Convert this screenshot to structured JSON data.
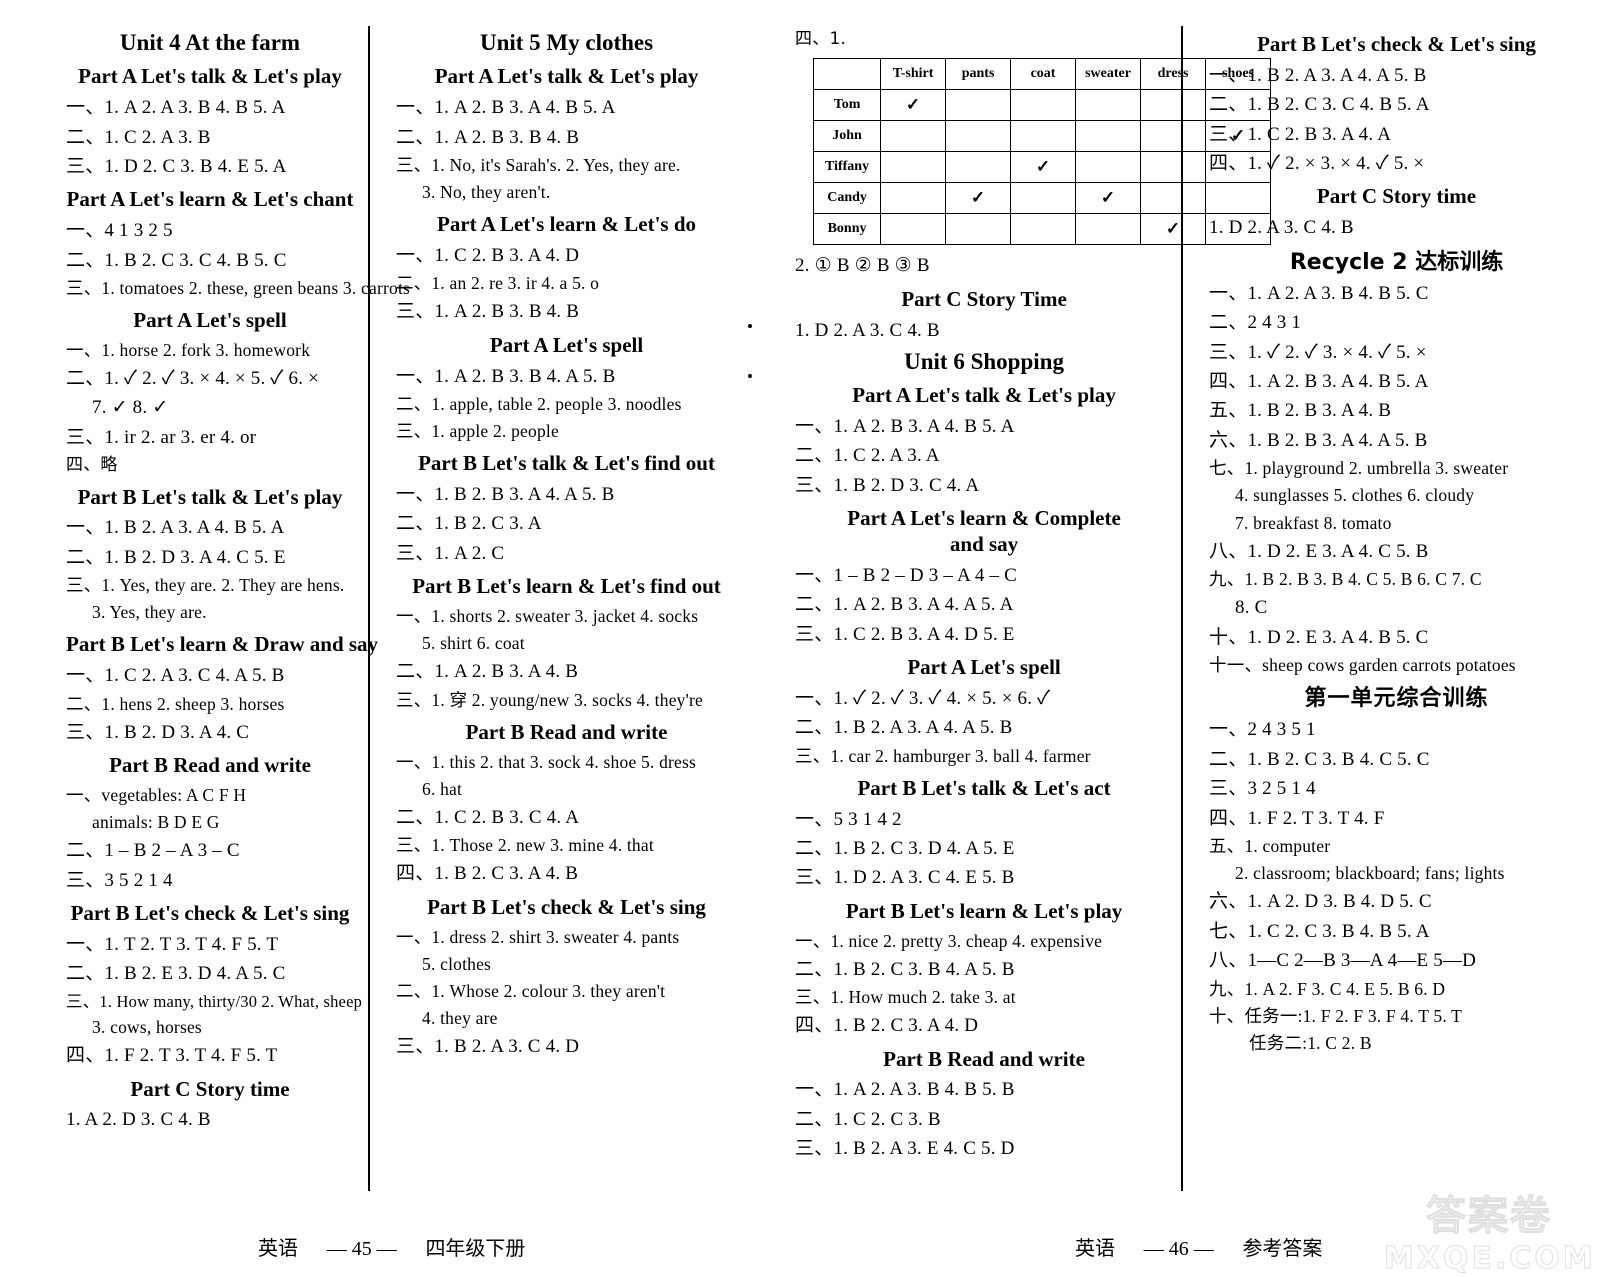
{
  "footer": {
    "left_subject": "英语",
    "left_page": "— 45 —",
    "left_book": "四年级下册",
    "right_subject": "英语",
    "right_page": "— 46 —",
    "right_book": "参考答案"
  },
  "watermark": {
    "line1": "答案卷",
    "line2": "MXQE.COM"
  },
  "col1": {
    "unit_title": "Unit 4    At the farm",
    "s1_header": "Part A    Let's talk & Let's play",
    "s1_l1": "一、1. A   2. A   3. B   4. B   5. A",
    "s1_l2": "二、1. C   2. A   3. B",
    "s1_l3": "三、1. D   2. C   3. B   4. E   5. A",
    "s2_header": "Part A    Let's learn & Let's chant",
    "s2_l1": "一、4   1   3   2   5",
    "s2_l2": "二、1. B   2. C   3. C   4. B   5. C",
    "s2_l3": "三、1. tomatoes   2. these, green beans   3. carrots",
    "s3_header": "Part A    Let's spell",
    "s3_l1": "一、1. horse   2. fork   3. homework",
    "s3_l2": "二、1. ✓   2. ✓   3. ×   4. ×   5. ✓   6. ×",
    "s3_l2b": "7. ✓   8. ✓",
    "s3_l3": "三、1. ir   2. ar   3. er   4. or",
    "s3_l4": "四、略",
    "s4_header": "Part B    Let's talk & Let's play",
    "s4_l1": "一、1. B   2. A   3. A   4. B   5. A",
    "s4_l2": "二、1. B   2. D   3. A   4. C   5. E",
    "s4_l3": "三、1. Yes, they are.    2. They are hens.",
    "s4_l3b": "3. Yes, they are.",
    "s5_header": "Part B    Let's learn & Draw and say",
    "s5_l1": "一、1. C   2. A   3. C   4. A   5. B",
    "s5_l2": "二、1. hens   2. sheep   3. horses",
    "s5_l3": "三、1. B   2. D   3. A   4. C",
    "s6_header": "Part B    Read and write",
    "s6_l1": "一、vegetables: A   C   F   H",
    "s6_l1b": "animals: B   D   E   G",
    "s6_l2": "二、1 – B   2 – A   3 – C",
    "s6_l3": "三、3   5   2   1   4",
    "s7_header": "Part B    Let's check & Let's sing",
    "s7_l1": "一、1. T   2. T   3. T   4. F   5. T",
    "s7_l2": "二、1. B   2. E   3. D   4. A   5. C",
    "s7_l3": "三、1. How many, thirty/30   2. What, sheep",
    "s7_l3b": "3. cows, horses",
    "s7_l4": "四、1. F   2. T   3. T   4. F   5. T",
    "s8_header": "Part C    Story time",
    "s8_l1": "1. A   2. D   3. C   4. B"
  },
  "col2": {
    "unit_title": "Unit 5    My clothes",
    "s1_header": "Part A    Let's talk & Let's play",
    "s1_l1": "一、1. A   2. B   3. A   4. B   5. A",
    "s1_l2": "二、1. A   2. B   3. B   4. B",
    "s1_l3": "三、1. No, it's Sarah's.    2. Yes, they are.",
    "s1_l3b": "3. No, they aren't.",
    "s2_header": "Part A    Let's learn & Let's do",
    "s2_l1": "一、1. C   2. B   3. A   4. D",
    "s2_l2": "二、1. an   2. re   3. ir   4. a   5. o",
    "s2_l3": "三、1. A   2. B   3. B   4. B",
    "s3_header": "Part A    Let's spell",
    "s3_l1": "一、1. A   2. B   3. B   4. A   5. B",
    "s3_l2": "二、1. apple, table   2. people   3. noodles",
    "s3_l3": "三、1. apple   2. people",
    "s4_header": "Part B    Let's talk & Let's find out",
    "s4_l1": "一、1. B   2. B   3. A   4. A   5. B",
    "s4_l2": "二、1. B   2. C   3. A",
    "s4_l3": "三、1. A   2. C",
    "s5_header": "Part B    Let's learn & Let's find out",
    "s5_l1": "一、1. shorts   2. sweater   3. jacket   4. socks",
    "s5_l1b": "5. shirt   6. coat",
    "s5_l2": "二、1. A   2. B   3. A   4. B",
    "s5_l3": "三、1. 穿   2. young/new   3. socks   4. they're",
    "s6_header": "Part B    Read and write",
    "s6_l1": "一、1. this   2. that   3. sock   4. shoe   5. dress",
    "s6_l1b": "6. hat",
    "s6_l2": "二、1. C   2. B   3. C   4. A",
    "s6_l3": "三、1. Those   2. new   3. mine   4. that",
    "s6_l4": "四、1. B   2. C   3. A   4. B",
    "s7_header": "Part B    Let's check & Let's sing",
    "s7_l1": "一、1. dress   2. shirt   3. sweater   4. pants",
    "s7_l1b": "5. clothes",
    "s7_l2": "二、1. Whose   2. colour   3. they aren't",
    "s7_l2b": "4. they are",
    "s7_l3": "三、1. B   2. A   3. C   4. D"
  },
  "col3": {
    "q4_label": "四、1.",
    "table": {
      "columns": [
        "",
        "T-shirt",
        "pants",
        "coat",
        "sweater",
        "dress",
        "shoes"
      ],
      "rows": [
        {
          "name": "Tom",
          "marks": [
            true,
            false,
            false,
            false,
            false,
            false
          ]
        },
        {
          "name": "John",
          "marks": [
            false,
            false,
            false,
            false,
            false,
            true
          ]
        },
        {
          "name": "Tiffany",
          "marks": [
            false,
            false,
            true,
            false,
            false,
            false
          ]
        },
        {
          "name": "Candy",
          "marks": [
            false,
            true,
            false,
            true,
            false,
            false
          ]
        },
        {
          "name": "Bonny",
          "marks": [
            false,
            false,
            false,
            false,
            true,
            false
          ]
        }
      ],
      "check_glyph": "✓"
    },
    "q4_2": "2. ① B    ② B    ③ B",
    "s1_header": "Part C    Story Time",
    "s1_l1": "1. D   2. A   3. C   4. B",
    "unit_title": "Unit 6    Shopping",
    "s2_header": "Part A    Let's talk & Let's play",
    "s2_l1": "一、1. A   2. B   3. A   4. B   5. A",
    "s2_l2": "二、1. C   2. A   3. A",
    "s2_l3": "三、1. B   2. D   3. C   4. A",
    "s3_header": "Part A    Let's learn & Complete",
    "s3_header2": "and say",
    "s3_l1": "一、1 – B   2 – D   3 – A   4 – C",
    "s3_l2": "二、1. A   2. B   3. A   4. A   5. A",
    "s3_l3": "三、1. C   2. B   3. A   4. D   5. E",
    "s4_header": "Part A    Let's spell",
    "s4_l1": "一、1. ✓   2. ✓   3. ✓   4. ×   5. ×   6. ✓",
    "s4_l2": "二、1. B   2. A   3. A   4. A   5. B",
    "s4_l3": "三、1. car   2. hamburger   3. ball   4. farmer",
    "s5_header": "Part B    Let's talk & Let's act",
    "s5_l1": "一、5   3   1   4   2",
    "s5_l2": "二、1. B   2. C   3. D   4. A   5. E",
    "s5_l3": "三、1. D   2. A   3. C   4. E   5. B",
    "s6_header": "Part B    Let's learn & Let's play",
    "s6_l1": "一、1. nice   2. pretty   3. cheap   4. expensive",
    "s6_l2": "二、1. B   2. C   3. B   4. A   5. B",
    "s6_l3": "三、1. How much   2. take   3. at",
    "s6_l4": "四、1. B   2. C   3. A   4. D",
    "s7_header": "Part B    Read and write",
    "s7_l1": "一、1. A   2. A   3. B   4. B   5. B",
    "s7_l2": "二、1. C   2. C   3. B",
    "s7_l3": "三、1. B   2. A   3. E   4. C   5. D"
  },
  "col4": {
    "s1_header": "Part B    Let's check & Let's sing",
    "s1_l1": "一、1. B   2. A   3. A   4. A   5. B",
    "s1_l2": "二、1. B   2. C   3. C   4. B   5. A",
    "s1_l3": "三、1. C   2. B   3. A   4. A",
    "s1_l4": "四、1. ✓   2. ×   3. ×   4. ✓   5. ×",
    "s2_header": "Part C    Story time",
    "s2_l1": "1. D   2. A   3. C   4. B",
    "recycle_header": "Recycle 2 达标训练",
    "r_l1": "一、1. A   2. A   3. B   4. B   5. C",
    "r_l2": "二、2   4   3   1",
    "r_l3": "三、1. ✓   2. ✓   3. ×   4. ✓   5. ×",
    "r_l4": "四、1. A   2. B   3. A   4. B   5. A",
    "r_l5": "五、1. B   2. B   3. A   4. B",
    "r_l6": "六、1. B   2. B   3. A   4. A   5. B",
    "r_l7": "七、1. playground   2. umbrella   3. sweater",
    "r_l7b": "4. sunglasses   5. clothes   6. cloudy",
    "r_l7c": "7. breakfast   8. tomato",
    "r_l8": "八、1. D   2. E   3. A   4. C   5. B",
    "r_l9": "九、1. B   2. B   3. B   4. C   5. B   6. C   7. C",
    "r_l9b": "8. C",
    "r_l10": "十、1. D   2. E   3. A   4. B   5. C",
    "r_l11": "十一、sheep   cows   garden   carrots   potatoes",
    "final_header": "第一单元综合训练",
    "f_l1": "一、2   4   3   5   1",
    "f_l2": "二、1. B   2. C   3. B   4. C   5. C",
    "f_l3": "三、3   2   5   1   4",
    "f_l4": "四、1. F   2. T   3. T   4. F",
    "f_l5": "五、1. computer",
    "f_l5b": "2. classroom; blackboard; fans; lights",
    "f_l6": "六、1. A   2. D   3. B   4. D   5. C",
    "f_l7": "七、1. C   2. C   3. B   4. B   5. A",
    "f_l8": "八、1—C   2—B   3—A   4—E   5—D",
    "f_l9": "九、1. A   2. F   3. C   4. E   5. B   6. D",
    "f_l10": "十、任务一:1. F   2. F   3. F   4. T   5. T",
    "f_l10b": "任务二:1. C   2. B"
  }
}
